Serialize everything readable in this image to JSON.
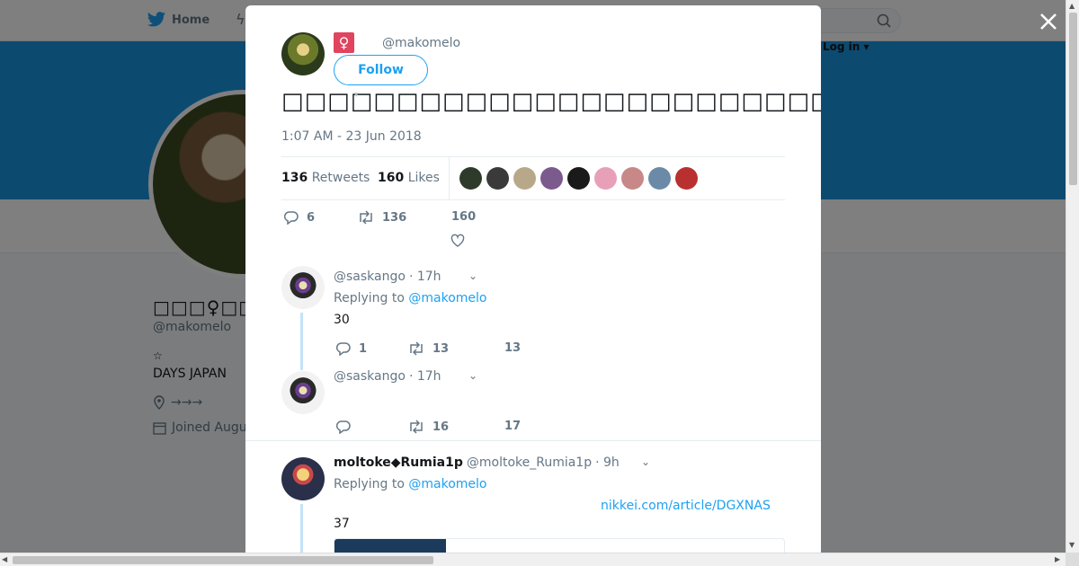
{
  "nav": {
    "home_label": "Home",
    "login_label": "Log in ▾"
  },
  "profile": {
    "name": "□□□♀□□□",
    "handle": "@makomelo",
    "star": "☆",
    "bio": "DAYS JAPAN",
    "location": "→→→",
    "joined": "Joined Augu"
  },
  "modal": {
    "handle": "@makomelo",
    "female_glyph": "♀",
    "follow_label": "Follow",
    "tweet_text": "□□□□□□□□□□□□□□□□□□□□□□□□□□□□□□□□□□□□□□□□□□□□□□□□□□□□□□",
    "timestamp": "1:07 AM - 23 Jun 2018",
    "retweets_count": "136",
    "retweets_label": "Retweets",
    "likes_count": "160",
    "likes_label": "Likes",
    "likers": [
      "#2e3b2a",
      "#3a3a3a",
      "#b8a88a",
      "#7b5a8e",
      "#1a1a1a",
      "#e8a0b8",
      "#c88888",
      "#6a8aa8",
      "#b83030"
    ],
    "actions": {
      "replies": "6",
      "retweets": "136",
      "likes": "160"
    }
  },
  "replies": [
    {
      "handle": "@saskango",
      "time": "· 17h",
      "replying_label": "Replying to",
      "replying_to": "@makomelo",
      "body": "30",
      "replies": "1",
      "retweets": "13",
      "likes": "13"
    },
    {
      "handle": "@saskango",
      "time": "· 17h",
      "replies": "",
      "retweets": "16",
      "likes": "17"
    }
  ],
  "reply3": {
    "name": "moltoke◆Rumia1p",
    "handle": "@moltoke_Rumia1p",
    "time": "· 9h",
    "replying_label": "Replying to",
    "replying_to": "@makomelo",
    "link": "nikkei.com/article/DGXNAS",
    "body": "37"
  },
  "colors": {
    "accent": "#1da1f2",
    "banner": "#1b95e0",
    "female_badge": "#e0445e"
  }
}
